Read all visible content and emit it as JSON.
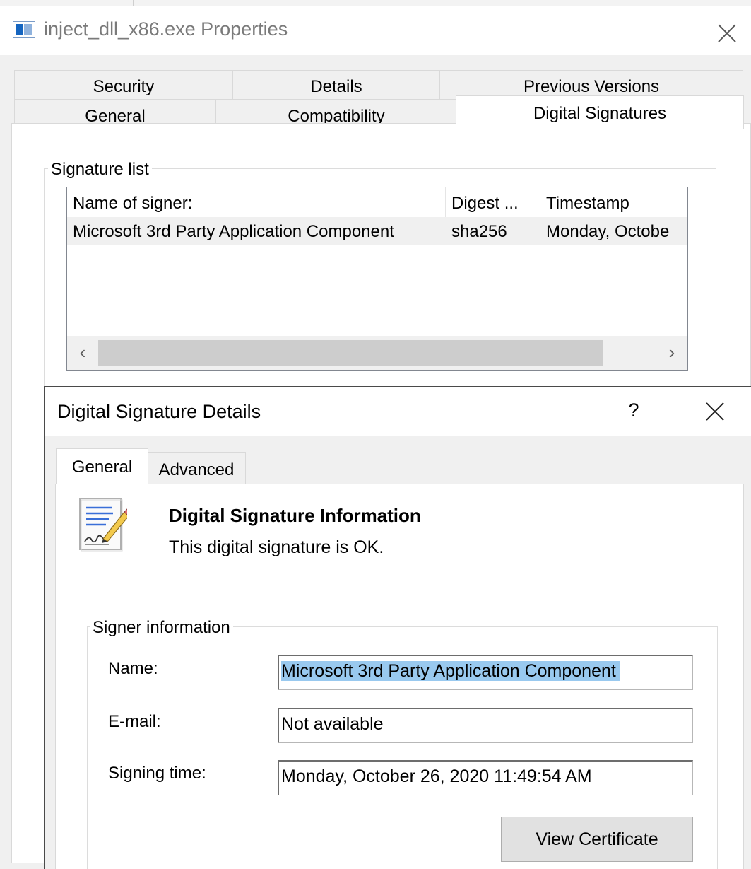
{
  "window": {
    "title": "inject_dll_x86.exe Properties",
    "tabs": {
      "security": "Security",
      "details": "Details",
      "previous_versions": "Previous Versions",
      "general": "General",
      "compatibility": "Compatibility",
      "digital_signatures": "Digital Signatures"
    },
    "active_tab": "Digital Signatures"
  },
  "signature_list": {
    "group_title": "Signature list",
    "columns": [
      "Name of signer:",
      "Digest ...",
      "Timestamp"
    ],
    "rows": [
      {
        "signer": "Microsoft 3rd Party Application Component",
        "digest": "sha256",
        "timestamp": "Monday, Octobe"
      }
    ],
    "scroll_left": "‹",
    "scroll_right": "›"
  },
  "dialog": {
    "title": "Digital Signature Details",
    "help": "?",
    "tabs": {
      "general": "General",
      "advanced": "Advanced"
    },
    "active_tab": "General",
    "info_title": "Digital Signature Information",
    "info_status": "This digital signature is OK.",
    "signer_group_title": "Signer information",
    "fields": {
      "name_label": "Name:",
      "name_value": "Microsoft 3rd Party Application Component",
      "email_label": "E-mail:",
      "email_value": "Not available",
      "signing_time_label": "Signing time:",
      "signing_time_value": "Monday, October 26, 2020 11:49:54 AM"
    },
    "view_certificate": "View Certificate"
  },
  "colors": {
    "selection": "#99c9ef",
    "button": "#e1e1e1",
    "window_bg": "#f0f0f0",
    "title_grey": "#7a7a7a"
  }
}
